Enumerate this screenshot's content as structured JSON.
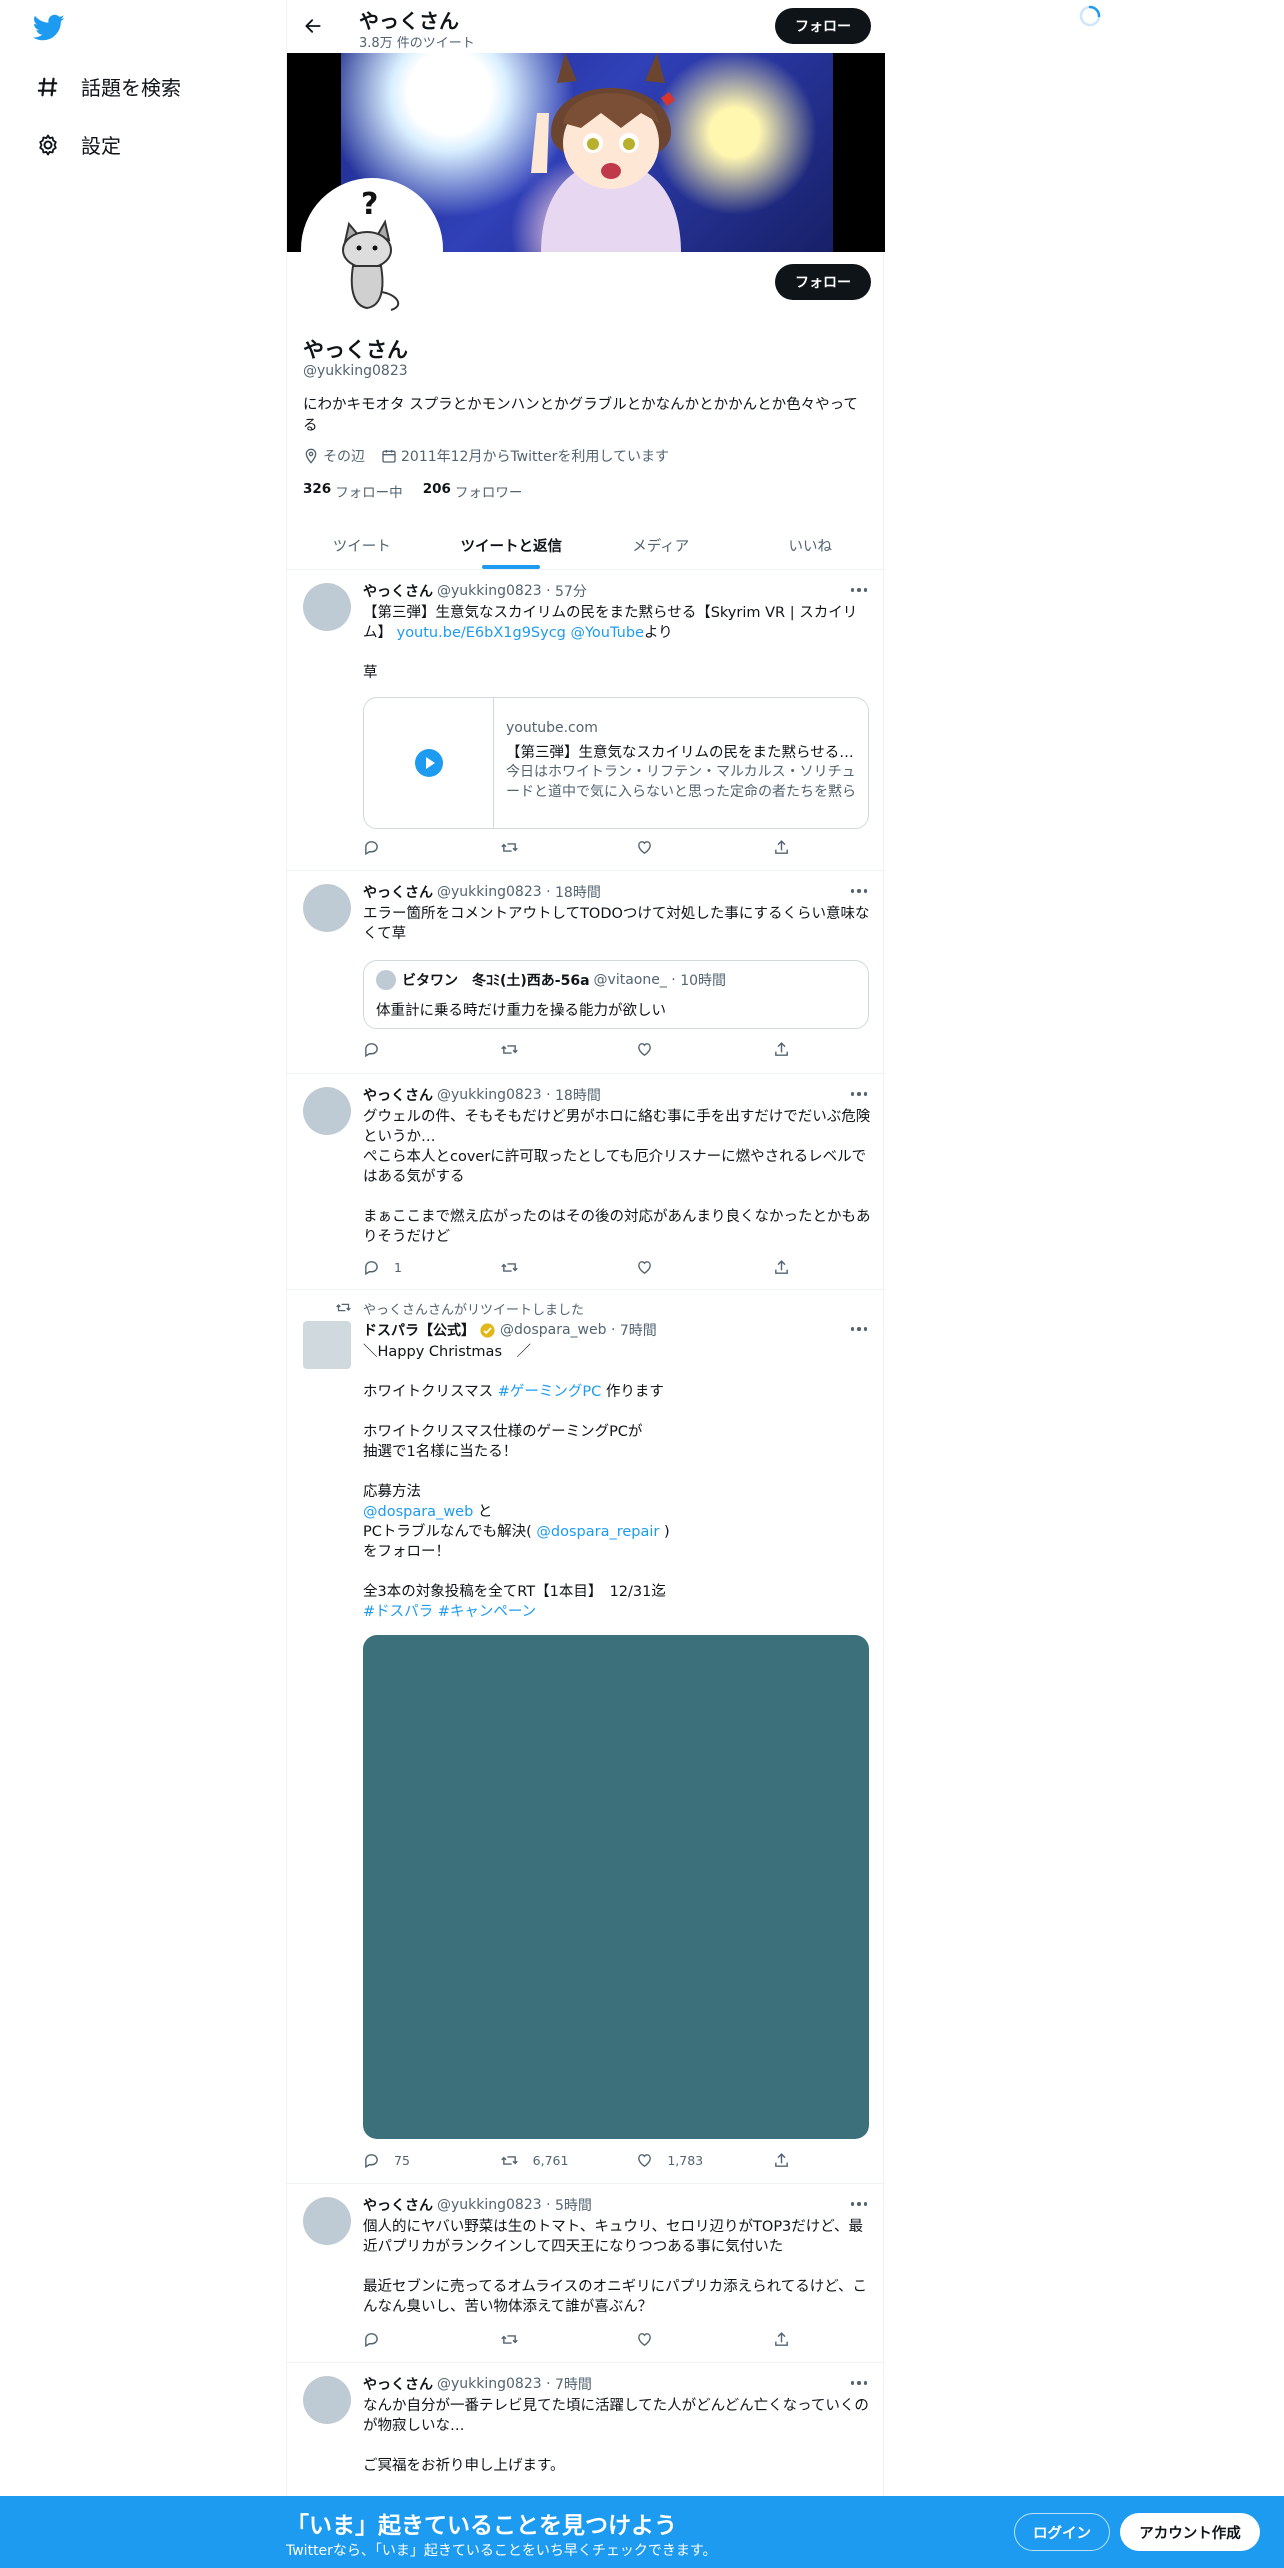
{
  "nav": {
    "logo": "twitter-bird-icon",
    "items": [
      {
        "label": "話題を検索",
        "icon": "hashtag-icon"
      },
      {
        "label": "設定",
        "icon": "gear-icon"
      }
    ]
  },
  "header": {
    "name": "やっくさん",
    "tweet_count": "3.8万 件のツイート",
    "follow_label": "フォロー"
  },
  "profile": {
    "name": "やっくさん",
    "handle": "@yukking0823",
    "bio": "にわかキモオタ スプラとかモンハンとかグラブルとかなんかとかかんとか色々やってる",
    "location": "その辺",
    "joined": "2011年12月からTwitterを利用しています",
    "following_count": "326",
    "following_label": "フォロー中",
    "followers_count": "206",
    "followers_label": "フォロワー",
    "follow_label": "フォロー",
    "avatar_glyph": "?"
  },
  "tabs": [
    {
      "label": "ツイート",
      "active": false
    },
    {
      "label": "ツイートと返信",
      "active": true
    },
    {
      "label": "メディア",
      "active": false
    },
    {
      "label": "いいね",
      "active": false
    }
  ],
  "tweets": [
    {
      "name": "やっくさん",
      "handle": "@yukking0823",
      "time": "57分",
      "text_pre": "【第三弾】生意気なスカイリムの民をまた黙らせる【Skyrim VR | スカイリム】 ",
      "link1": "youtu.be/E6bX1g9Sycg",
      "link2": "@YouTube",
      "text_post": "より",
      "text_extra": "草",
      "card": {
        "domain": "youtube.com",
        "title": "【第三弾】生意気なスカイリムの民をまた黙らせる【Skyrim VR | スカイリム】",
        "description": "今日はホワイトラン・リフテン・マルカルス・ソリチュードと道中で気に入らないと思った定命の者たちを黙らせます"
      },
      "replies": "",
      "retweets": "",
      "likes": ""
    },
    {
      "name": "やっくさん",
      "handle": "@yukking0823",
      "time": "18時間",
      "text": "エラー箇所をコメントアウトしてTODOつけて対処した事にするくらい意味なくて草",
      "quote": {
        "name": "ビタワン　冬ｺﾐ(土)西あ-56a",
        "handle": "@vitaone_",
        "time": "10時間",
        "text": "体重計に乗る時だけ重力を操る能力が欲しい"
      }
    },
    {
      "name": "やっくさん",
      "handle": "@yukking0823",
      "time": "18時間",
      "text": "グウェルの件、そもそもだけど男がホロに絡む事に手を出すだけでだいぶ危険というか…\nぺこら本人とcoverに許可取ったとしても厄介リスナーに燃やされるレベルではある気がする\n\nまぁここまで燃え広がったのはその後の対応があんまり良くなかったとかもありそうだけど",
      "replies": "1"
    },
    {
      "retweet_note": "やっくさんさんがリツイートしました",
      "name": "ドスパラ【公式】",
      "handle": "@dospara_web",
      "time": "7時間",
      "line1": "＼Happy Christmas　／",
      "line2_pre": "ホワイトクリスマス ",
      "line2_tag": "#ゲーミングPC",
      "line2_post": " 作ります",
      "line3": "ホワイトクリスマス仕様のゲーミングPCが\n抽選で1名様に当たる！",
      "line4": "応募方法",
      "mention1": "@dospara_web",
      "line5": " と",
      "line6_pre": "PCトラブルなんでも解決( ",
      "mention2": "@dospara_repair",
      "line6_post": " )",
      "line7": "をフォロー！",
      "line8": "全3本の対象投稿を全てRT【1本目】　12/31迄",
      "tags": "#ドスパラ #キャンペーン",
      "replies": "75",
      "retweets": "6,761",
      "likes": "1,783"
    },
    {
      "name": "やっくさん",
      "handle": "@yukking0823",
      "time": "5時間",
      "text": "個人的にヤバい野菜は生のトマト、キュウリ、セロリ辺りがTOP3だけど、最近パプリカがランクインして四天王になりつつある事に気付いた\n\n最近セブンに売ってるオムライスのオニギリにパプリカ添えられてるけど、こんなん臭いし、苦い物体添えて誰が喜ぶん？"
    },
    {
      "name": "やっくさん",
      "handle": "@yukking0823",
      "time": "7時間",
      "text": "なんか自分が一番テレビ見てた頃に活躍してた人がどんどん亡くなっていくのが物寂しいな…\n\nご冥福をお祈り申し上げます。"
    }
  ],
  "bottom_bar": {
    "title": "「いま」起きていることを見つけよう",
    "subtitle": "Twitterなら、「いま」起きていることをいち早くチェックできます。",
    "login_label": "ログイン",
    "signup_label": "アカウント作成"
  },
  "colors": {
    "accent": "#1d9bf0",
    "text_secondary": "#536471",
    "button_dark": "#0f1419",
    "media_placeholder": "#3c717c",
    "verified": "#e2b719"
  }
}
